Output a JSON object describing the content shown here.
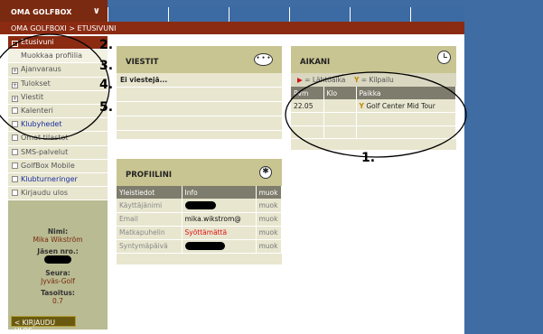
{
  "header": {
    "brand": "OMA GOLFBOX",
    "breadcrumb": "OMA GOLFBOXI > ETUSIVUNI"
  },
  "sidebar": {
    "items": [
      {
        "label": "Etusivuni",
        "box": "−"
      },
      {
        "label": "Muokkaa profiilia",
        "box": ""
      },
      {
        "label": "Ajanvaraus",
        "box": "+"
      },
      {
        "label": "Tulokset",
        "box": "+"
      },
      {
        "label": "Viestit",
        "box": "+"
      },
      {
        "label": "Kalenteri",
        "box": ""
      },
      {
        "label": "Klubyhedet",
        "box": ""
      },
      {
        "label": "Omat tilastot",
        "box": ""
      },
      {
        "label": "SMS-palvelut",
        "box": ""
      },
      {
        "label": "GolfBox Mobile",
        "box": ""
      },
      {
        "label": "Klubturneringer",
        "box": ""
      },
      {
        "label": "Kirjaudu ulos",
        "box": ""
      }
    ],
    "user": {
      "name_label": "Nimi:",
      "name": "Mika Wikström",
      "member_label": "Jäsen nro.:",
      "club_label": "Seura:",
      "club": "Jyväs-Golf",
      "hcp_label": "Tasoitus:",
      "hcp": "0.7",
      "logout": "< KIRJAUDU ULOS"
    }
  },
  "messages": {
    "title": "VIESTIT",
    "icon": "speech-bubble-icon",
    "empty_text": "Ei viestejä..."
  },
  "times": {
    "title": "AIKANI",
    "icon": "clock-icon",
    "legend_start_symbol": "▶",
    "legend_start": "= Lähtöaika",
    "legend_comp_symbol": "🏆",
    "legend_comp": "= Kilpailu",
    "columns": [
      "Pvm",
      "Klo",
      "Paikka"
    ],
    "rows": [
      {
        "date": "22.05",
        "time": "",
        "place": "Golf Center Mid Tour"
      }
    ]
  },
  "profile": {
    "title": "PROFIILINI",
    "icon": "accessibility-icon",
    "columns": [
      "Yleistiedot",
      "Info",
      "muok"
    ],
    "rows": [
      {
        "key": "Käyttäjänimi",
        "value": "",
        "more": "muok"
      },
      {
        "key": "Email",
        "value": "mika.wikstrom@",
        "more": "muok"
      },
      {
        "key": "Matkapuhelin",
        "value": "Syöttämättä",
        "more": "muok"
      },
      {
        "key": "Syntymäpäivä",
        "value": "",
        "more": "muok"
      }
    ]
  },
  "annotations": [
    "1.",
    "2.",
    "3.",
    "4.",
    "5."
  ],
  "colors": {
    "brand_bg": "#7a2a10",
    "top_bar": "#3f6ca3",
    "panel_bg": "#e8e6cf",
    "panel_head": "#c9c592",
    "table_head": "#7e7c6c",
    "warn": "#e01010"
  }
}
